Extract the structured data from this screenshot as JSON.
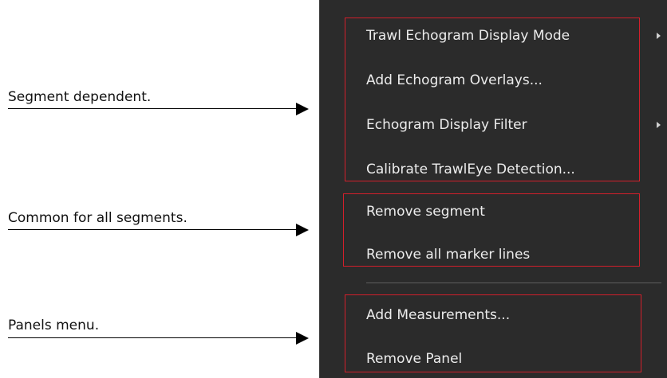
{
  "annotations": [
    {
      "id": "segment-dependent",
      "label": "Segment dependent."
    },
    {
      "id": "common",
      "label": "Common for all segments."
    },
    {
      "id": "panels",
      "label": "Panels menu."
    }
  ],
  "menu": {
    "segment_group": [
      {
        "label": "Trawl Echogram Display Mode",
        "has_submenu": true
      },
      {
        "label": "Add Echogram Overlays...",
        "has_submenu": false
      },
      {
        "label": "Echogram Display Filter",
        "has_submenu": true
      },
      {
        "label": "Calibrate TrawlEye Detection...",
        "has_submenu": false
      }
    ],
    "common_group": [
      {
        "label": "Remove segment"
      },
      {
        "label": "Remove all marker lines"
      }
    ],
    "panels_group": [
      {
        "label": "Add Measurements..."
      },
      {
        "label": "Remove Panel"
      }
    ]
  },
  "colors": {
    "menu_background": "#2b2b2b",
    "menu_text": "#ececec",
    "highlight_box": "#d21f2b",
    "separator": "#5e5e5e"
  }
}
